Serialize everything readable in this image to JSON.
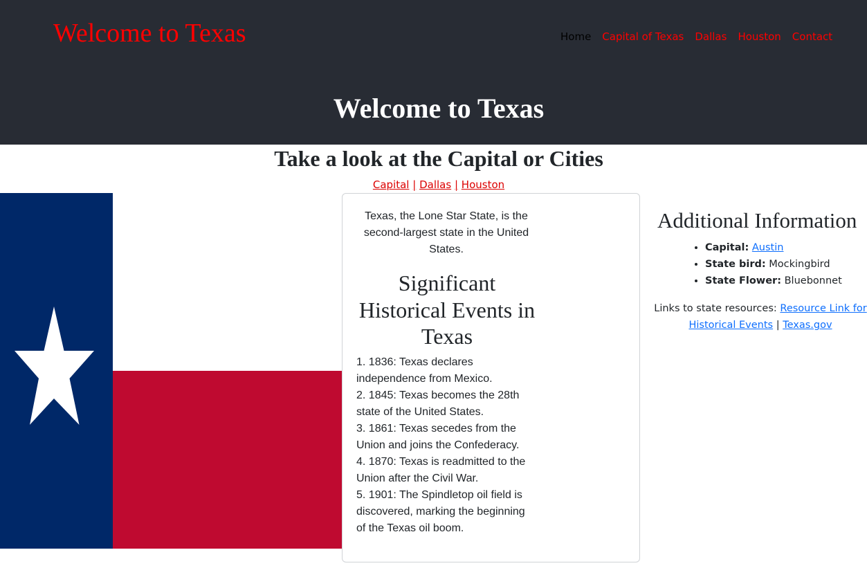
{
  "header": {
    "brand": "Welcome to Texas",
    "nav": [
      "Home",
      "Capital of Texas",
      "Dallas",
      "Houston",
      "Contact"
    ],
    "hero_title": "Welcome to Texas",
    "bg_color": "#282c34",
    "accent_color": "#ff0000"
  },
  "intro": {
    "subtitle": "Take a look at the Capital or Cities",
    "links": [
      "Capital",
      "Dallas",
      "Houston"
    ],
    "separator": "|"
  },
  "flag": {
    "colors": {
      "blue": "#002868",
      "white": "#ffffff",
      "red": "#bf0a30"
    }
  },
  "card": {
    "intro": "Texas, the Lone Star State, is the second-largest state in the United States.",
    "heading": "Significant Historical Events in Texas",
    "events": [
      "1. 1836: Texas declares independence from Mexico.",
      "2. 1845: Texas becomes the 28th state of the United States.",
      "3. 1861: Texas secedes from the Union and joins the Confederacy.",
      "4. 1870: Texas is readmitted to the Union after the Civil War.",
      "5. 1901: The Spindletop oil field is discovered, marking the beginning of the Texas oil boom."
    ]
  },
  "additional": {
    "title": "Additional Information",
    "facts": [
      {
        "label": "Capital:",
        "value": "Austin",
        "is_link": true
      },
      {
        "label": "State bird:",
        "value": "Mockingbird",
        "is_link": false
      },
      {
        "label": "State Flower:",
        "value": "Bluebonnet",
        "is_link": false
      }
    ],
    "resources_prefix": "Links to state resources:",
    "resource_links": [
      "Resource Link for Historical Events",
      "Texas.gov"
    ],
    "resource_separator": "|"
  }
}
